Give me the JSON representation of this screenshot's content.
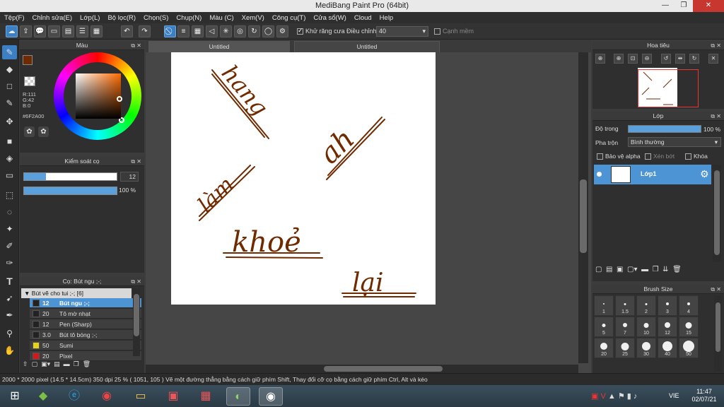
{
  "window": {
    "title": "MediBang Paint Pro (64bit)"
  },
  "menu": [
    "Tệp(F)",
    "Chỉnh sửa(E)",
    "Lớp(L)",
    "Bộ lọc(R)",
    "Chọn(S)",
    "Chụp(N)",
    "Màu (C)",
    "Xem(V)",
    "Công cụ(T)",
    "Cửa sổ(W)",
    "Cloud",
    "Help"
  ],
  "toolbar": {
    "antialias_label": "Khử răng cưa",
    "correction_label": "Điều chỉnh",
    "correction_value": "40",
    "soft_edge_label": "Cạnh mềm"
  },
  "color_panel": {
    "title": "Màu",
    "r": "R:111",
    "g": "G:42",
    "b": "B:0",
    "hex": "#6F2A00",
    "primary_color": "#6f2a00"
  },
  "brush_control": {
    "title": "Kiểm soát cọ",
    "size": "12",
    "opacity": "100 %",
    "size_fraction": 0.24,
    "opacity_fraction": 1.0
  },
  "brush_panel": {
    "title": "Cọ: Bút ngu ;-;",
    "group": "Bút vẽ cho tui ;-; [6]",
    "items": [
      {
        "size": "12",
        "name": "Bút ngu ;-;",
        "color": "#222222",
        "selected": true
      },
      {
        "size": "20",
        "name": "Tô mờ nhạt",
        "color": "#222222",
        "selected": false
      },
      {
        "size": "12",
        "name": "Pen (Sharp)",
        "color": "#222222",
        "selected": false
      },
      {
        "size": "3.0",
        "name": "Bút tô bóng ;-;",
        "color": "#222222",
        "selected": false
      },
      {
        "size": "50",
        "name": "Sumi",
        "color": "#e8d21a",
        "selected": false
      },
      {
        "size": "20",
        "name": "Pixel",
        "color": "#d21a1a",
        "selected": false
      }
    ]
  },
  "canvas": {
    "tabs": [
      "Untitled",
      "Untitled"
    ],
    "writing": [
      "hang",
      "ah",
      "làm",
      "khoẻ",
      "lại"
    ]
  },
  "navigator": {
    "title": "Hoa tiêu"
  },
  "layer_panel": {
    "title": "Lớp",
    "opacity_label": "Độ trong",
    "opacity_value": "100 %",
    "opacity_fraction": 1.0,
    "blend_label": "Pha trộn",
    "blend_value": "Bình thường",
    "protect_alpha": "Bảo vệ alpha",
    "clipping": "Xén bớt",
    "lock": "Khóa",
    "layers": [
      {
        "name": "Lớp1"
      }
    ]
  },
  "brush_size": {
    "title": "Brush Size",
    "sizes": [
      "1",
      "1.5",
      "2",
      "3",
      "4",
      "5",
      "7",
      "10",
      "12",
      "15",
      "20",
      "25",
      "30",
      "40",
      "50"
    ]
  },
  "status": {
    "text": "2000 * 2000 pixel   (14.5 * 14.5cm)   350 dpi   25 %   ( 1051, 105 )   Vẽ một đường thẳng bằng cách giữ phím Shift, Thay đổi cỡ cọ bằng cách giữ phím Ctrl, Alt và kéo"
  },
  "taskbar": {
    "language": "VIE",
    "time": "11:47",
    "date": "02/07/21"
  }
}
